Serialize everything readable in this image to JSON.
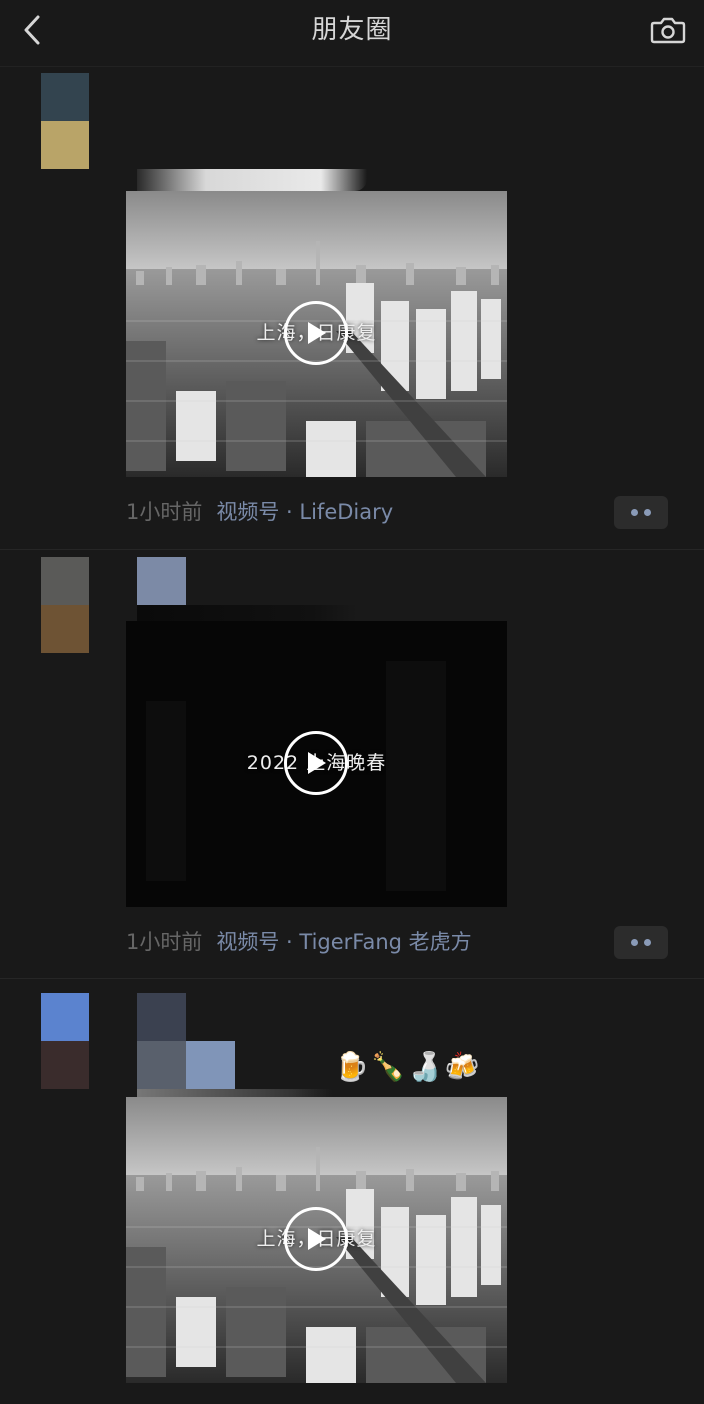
{
  "navbar": {
    "title": "朋友圈",
    "back_icon": "chevron-left-icon",
    "camera_icon": "camera-icon"
  },
  "colors": {
    "background": "#191919",
    "link": "#7a8aa8",
    "muted": "#666666"
  },
  "posts": [
    {
      "avatar_colors": [
        "#33444f",
        "#b9a468"
      ],
      "video": {
        "title": "上海，日康复",
        "style": "city"
      },
      "time": "1小时前",
      "source": "视频号 · LifeDiary"
    },
    {
      "avatar_colors": [
        "#5a5a58",
        "#6e5334"
      ],
      "video": {
        "title": "2022 上海晚春",
        "style": "dark"
      },
      "time": "1小时前",
      "source": "视频号 · TigerFang 老虎方"
    },
    {
      "avatar_colors": [
        "#5b83cf",
        "#3a2c2c"
      ],
      "emojis": "🍺🍾🍶🍻",
      "video": {
        "title": "上海，日康复",
        "style": "city"
      }
    }
  ]
}
